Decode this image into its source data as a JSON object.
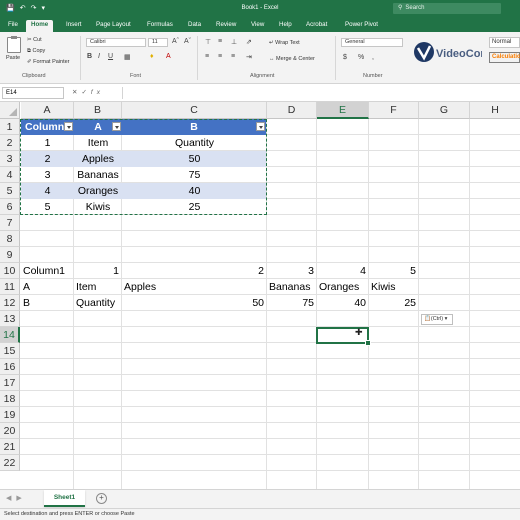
{
  "window": {
    "title": "Book1 - Excel",
    "search_placeholder": "Search"
  },
  "tabs": [
    "File",
    "Home",
    "Insert",
    "Page Layout",
    "Formulas",
    "Data",
    "Review",
    "View",
    "Help",
    "Acrobat",
    "Power Pivot"
  ],
  "ribbon": {
    "clipboard": {
      "paste": "Paste",
      "cut": "Cut",
      "copy": "Copy",
      "format_painter": "Format Painter",
      "label": "Clipboard"
    },
    "font": {
      "name": "Calibri",
      "size": "11",
      "label": "Font"
    },
    "alignment": {
      "wrap_text": "Wrap Text",
      "merge_center": "Merge & Center",
      "label": "Alignment"
    },
    "number": {
      "format": "General",
      "label": "Number"
    },
    "styles": {
      "normal": "Normal",
      "calculation": "Calculation"
    },
    "watermark": "VideoCorp"
  },
  "formula_bar": {
    "name_box": "E14",
    "fx": "fx",
    "value": ""
  },
  "columns": [
    "A",
    "B",
    "C",
    "D",
    "E",
    "F",
    "G",
    "H"
  ],
  "selected_column": "E",
  "rows": [
    "1",
    "2",
    "3",
    "4",
    "5",
    "6",
    "7",
    "8",
    "9",
    "10",
    "11",
    "12",
    "13",
    "14",
    "15",
    "16",
    "17",
    "18",
    "19",
    "20",
    "21",
    "22"
  ],
  "selected_row": "14",
  "table": {
    "headers": [
      "Column1",
      "A",
      "B"
    ],
    "rows": [
      [
        "1",
        "Item",
        "Quantity"
      ],
      [
        "2",
        "Apples",
        "50"
      ],
      [
        "3",
        "Bananas",
        "75"
      ],
      [
        "4",
        "Oranges",
        "40"
      ],
      [
        "5",
        "Kiwis",
        "25"
      ]
    ]
  },
  "pasted": {
    "row10": [
      "Column1",
      "1",
      "2",
      "3",
      "4",
      "5"
    ],
    "row11": [
      "A",
      "Item",
      "Apples",
      "Bananas",
      "Oranges",
      "Kiwis"
    ],
    "row12": [
      "B",
      "Quantity",
      "50",
      "75",
      "40",
      "25"
    ]
  },
  "paste_options": "(Ctrl)",
  "sheets": [
    "Sheet1"
  ],
  "status": "Select destination and press ENTER or choose Paste"
}
